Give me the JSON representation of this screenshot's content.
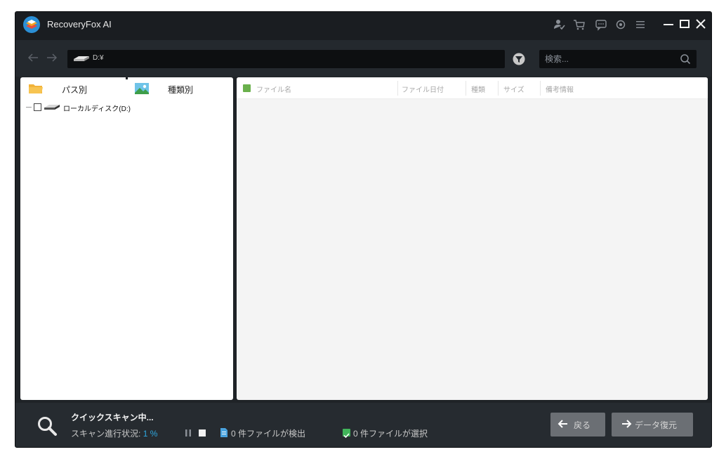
{
  "app": {
    "title": "RecoveryFox AI"
  },
  "toolbar": {
    "path": "D:¥",
    "search_placeholder": "検索..."
  },
  "left_panel": {
    "tabs": [
      {
        "label": "パス別"
      },
      {
        "label": "種類別"
      }
    ],
    "tree": [
      {
        "label": "ローカルディスク(D:)",
        "checked": false
      }
    ]
  },
  "file_table": {
    "columns": [
      "ファイル名",
      "ファイル日付",
      "種類",
      "サイズ",
      "備考情報"
    ],
    "rows": []
  },
  "status": {
    "title": "クイックスキャン中...",
    "progress_label": "スキャン進行状況:",
    "progress_value": "1 %",
    "found_text": "0 件ファイルが検出",
    "selected_text": "0 件ファイルが選択"
  },
  "buttons": {
    "back": "戻る",
    "recover": "データ復元"
  },
  "colors": {
    "accent": "#2ea8e0",
    "check_green": "#41b45a",
    "background": "#1f2327"
  }
}
